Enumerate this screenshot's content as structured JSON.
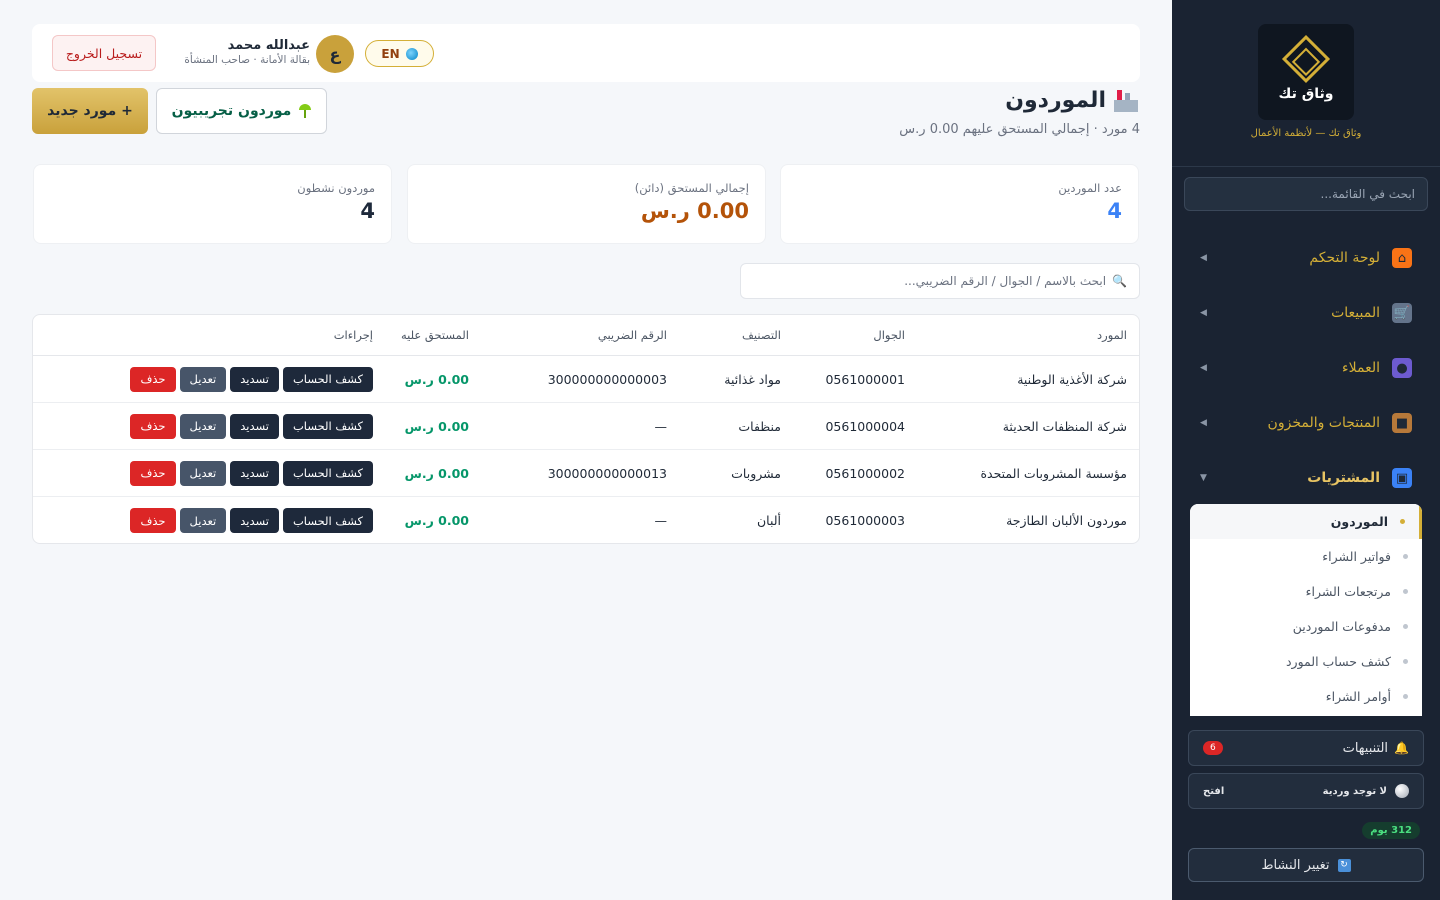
{
  "sidebar": {
    "logo_text": "وثاق تك",
    "brand_tagline": "وثاق تك — لأنظمة الأعمال",
    "search_placeholder": "ابحث في القائمة...",
    "nav": [
      {
        "label": "لوحة التحكم",
        "icon": "home-icon"
      },
      {
        "label": "المبيعات",
        "icon": "cart-icon"
      },
      {
        "label": "العملاء",
        "icon": "users-icon"
      },
      {
        "label": "المنتجات والمخزون",
        "icon": "box-icon"
      },
      {
        "label": "المشتريات",
        "icon": "purchases-icon"
      }
    ],
    "submenu": [
      {
        "label": "الموردون"
      },
      {
        "label": "فواتير الشراء"
      },
      {
        "label": "مرتجعات الشراء"
      },
      {
        "label": "مدفوعات الموردين"
      },
      {
        "label": "كشف حساب المورد"
      },
      {
        "label": "أوامر الشراء"
      }
    ],
    "notifications_label": "التنبيهات",
    "notifications_count": "6",
    "shift_label": "لا توجد وردية",
    "shift_open": "افتح",
    "days_badge": "312 يوم",
    "switch_label": "تغيير النشاط"
  },
  "topbar": {
    "logout": "تسجيل الخروج",
    "user_name": "عبدالله محمد",
    "user_sub": "بقالة الأمانة · صاحب المنشأة",
    "avatar_letter": "ع",
    "lang": "EN"
  },
  "page": {
    "title": "الموردون",
    "subtitle": "4 مورد · إجمالي المستحق عليهم 0.00 ر.س",
    "new_button": "+ مورد جديد",
    "demo_button": "موردون تجريبيون"
  },
  "stats": [
    {
      "label": "عدد الموردين",
      "value": "4",
      "color": "#3b82f6"
    },
    {
      "label": "إجمالي المستحق (دائن)",
      "value": "0.00 ر.س",
      "color": "#b45309"
    },
    {
      "label": "موردون نشطون",
      "value": "4",
      "color": "#1e293b"
    }
  ],
  "search": {
    "placeholder": "ابحث بالاسم / الجوال / الرقم الضريبي..."
  },
  "table": {
    "headers": {
      "name": "المورد",
      "phone": "الجوال",
      "category": "التصنيف",
      "tax": "الرقم الضريبي",
      "due": "المستحق عليه",
      "actions": "إجراءات"
    },
    "actions": {
      "statement": "كشف الحساب",
      "pay": "تسديد",
      "edit": "تعديل",
      "delete": "حذف"
    },
    "rows": [
      {
        "name": "شركة الأغذية الوطنية",
        "phone": "0561000001",
        "category": "مواد غذائية",
        "tax": "300000000000003",
        "due": "0.00 ر.س"
      },
      {
        "name": "شركة المنظفات الحديثة",
        "phone": "0561000004",
        "category": "منظفات",
        "tax": "—",
        "due": "0.00 ر.س"
      },
      {
        "name": "مؤسسة المشروبات المتحدة",
        "phone": "0561000002",
        "category": "مشروبات",
        "tax": "300000000000013",
        "due": "0.00 ر.س"
      },
      {
        "name": "موردون الألبان الطازجة",
        "phone": "0561000003",
        "category": "ألبان",
        "tax": "—",
        "due": "0.00 ر.س"
      }
    ]
  }
}
